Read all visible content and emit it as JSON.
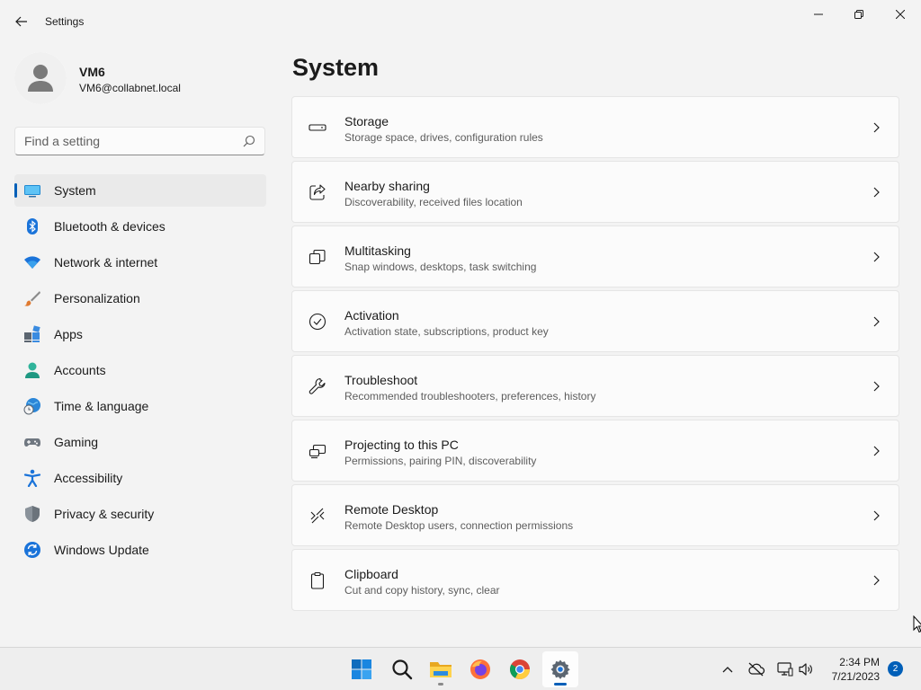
{
  "window": {
    "title": "Settings"
  },
  "profile": {
    "name": "VM6",
    "email": "VM6@collabnet.local"
  },
  "search": {
    "placeholder": "Find a setting",
    "value": ""
  },
  "nav": {
    "selected": "System",
    "items": [
      {
        "label": "System",
        "icon": "system-icon"
      },
      {
        "label": "Bluetooth & devices",
        "icon": "bluetooth-icon"
      },
      {
        "label": "Network & internet",
        "icon": "wifi-icon"
      },
      {
        "label": "Personalization",
        "icon": "brush-icon"
      },
      {
        "label": "Apps",
        "icon": "apps-icon"
      },
      {
        "label": "Accounts",
        "icon": "person-icon"
      },
      {
        "label": "Time & language",
        "icon": "globe-clock-icon"
      },
      {
        "label": "Gaming",
        "icon": "gamepad-icon"
      },
      {
        "label": "Accessibility",
        "icon": "accessibility-icon"
      },
      {
        "label": "Privacy & security",
        "icon": "shield-icon"
      },
      {
        "label": "Windows Update",
        "icon": "update-icon"
      }
    ]
  },
  "main": {
    "title": "System",
    "cards": [
      {
        "title": "Storage",
        "desc": "Storage space, drives, configuration rules",
        "icon": "storage-icon"
      },
      {
        "title": "Nearby sharing",
        "desc": "Discoverability, received files location",
        "icon": "share-icon"
      },
      {
        "title": "Multitasking",
        "desc": "Snap windows, desktops, task switching",
        "icon": "multitasking-icon"
      },
      {
        "title": "Activation",
        "desc": "Activation state, subscriptions, product key",
        "icon": "checkmark-circle-icon"
      },
      {
        "title": "Troubleshoot",
        "desc": "Recommended troubleshooters, preferences, history",
        "icon": "wrench-icon"
      },
      {
        "title": "Projecting to this PC",
        "desc": "Permissions, pairing PIN, discoverability",
        "icon": "projecting-icon"
      },
      {
        "title": "Remote Desktop",
        "desc": "Remote Desktop users, connection permissions",
        "icon": "remote-desktop-icon"
      },
      {
        "title": "Clipboard",
        "desc": "Cut and copy history, sync, clear",
        "icon": "clipboard-icon"
      }
    ]
  },
  "taskbar": {
    "apps": [
      "start-icon",
      "search-icon",
      "file-explorer-icon",
      "firefox-icon",
      "chrome-icon",
      "settings-icon"
    ],
    "active_app": "settings-icon",
    "time": "2:34 PM",
    "date": "7/21/2023",
    "notification_count": "2"
  },
  "colors": {
    "accent": "#005fb8",
    "background": "#f3f3f3",
    "card": "#fbfbfb"
  }
}
